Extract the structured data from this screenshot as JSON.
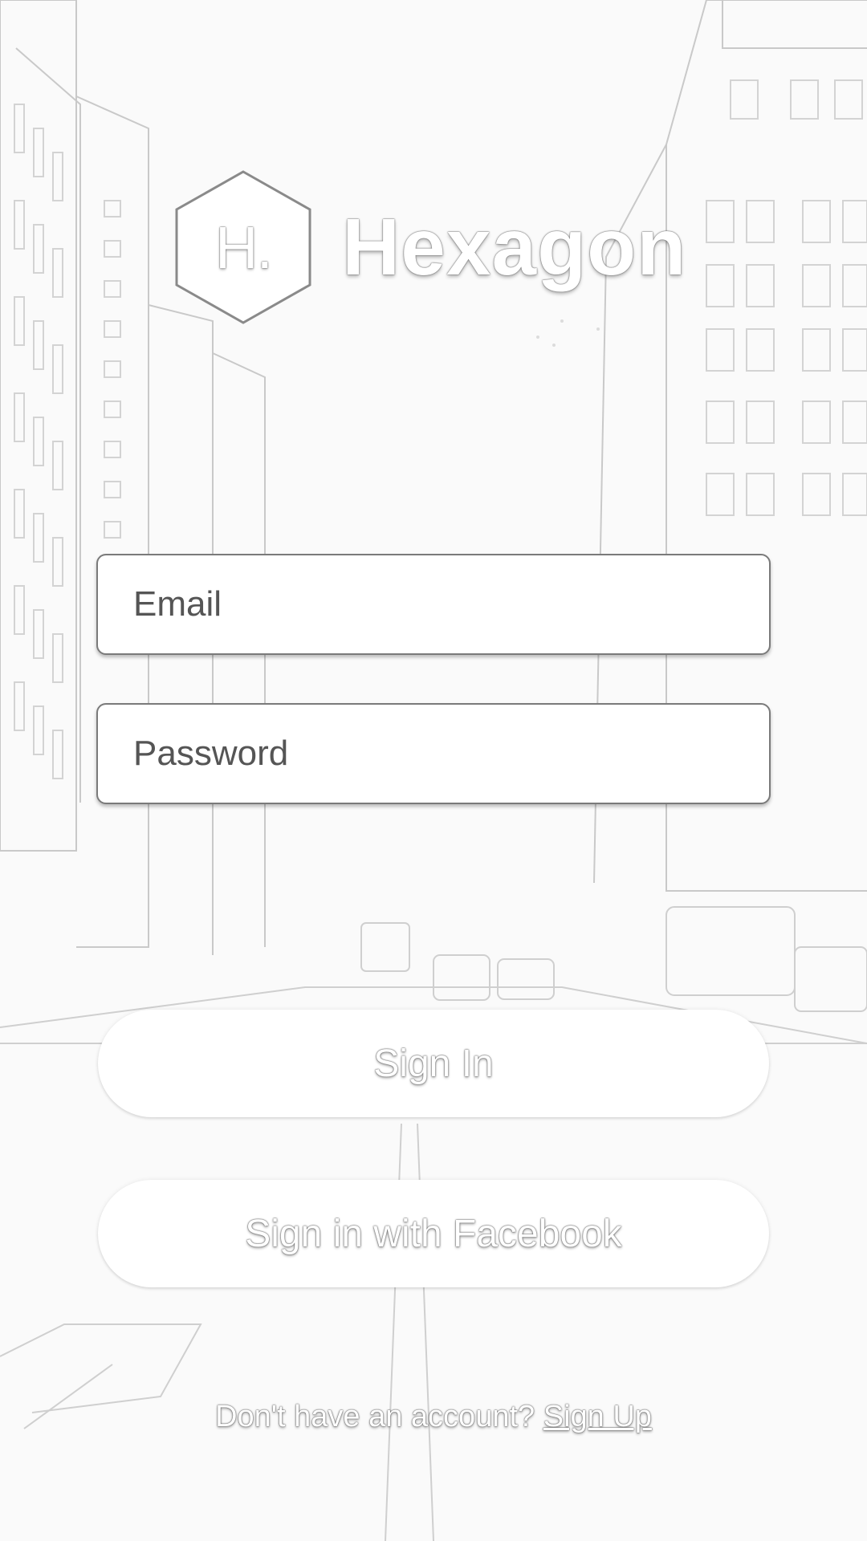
{
  "app": {
    "logo_letter": "H.",
    "name": "Hexagon"
  },
  "form": {
    "email": {
      "placeholder": "Email",
      "value": ""
    },
    "password": {
      "placeholder": "Password",
      "value": ""
    }
  },
  "buttons": {
    "sign_in": "Sign In",
    "facebook": "Sign in with Facebook"
  },
  "footer": {
    "prompt": "Don't have an account?",
    "signup_link": "Sign Up"
  },
  "icons": {
    "logo": "hexagon-logo-icon"
  },
  "colors": {
    "background": "#fafafa",
    "field_background": "#ffffff",
    "button_background": "#ffffff",
    "text_outline": "#555555"
  }
}
